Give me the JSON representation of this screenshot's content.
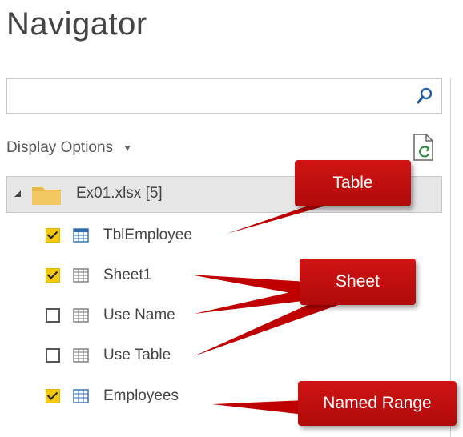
{
  "navigator": {
    "title": "Navigator",
    "search": {
      "value": "",
      "placeholder": ""
    },
    "display_options_label": "Display Options",
    "root": {
      "label": "Ex01.xlsx [5]"
    },
    "items": [
      {
        "label": "TblEmployee",
        "checked": true,
        "icon": "table-icon"
      },
      {
        "label": "Sheet1",
        "checked": true,
        "icon": "sheet-icon"
      },
      {
        "label": "Use Name",
        "checked": false,
        "icon": "sheet-icon"
      },
      {
        "label": "Use Table",
        "checked": false,
        "icon": "sheet-icon"
      },
      {
        "label": "Employees",
        "checked": true,
        "icon": "named-range-icon"
      }
    ]
  },
  "callouts": {
    "table": "Table",
    "sheet": "Sheet",
    "named_range": "Named Range"
  },
  "colors": {
    "checkbox_checked": "#f2c811",
    "callout_red": "#c00000",
    "table_icon_blue": "#2b6cb0"
  }
}
